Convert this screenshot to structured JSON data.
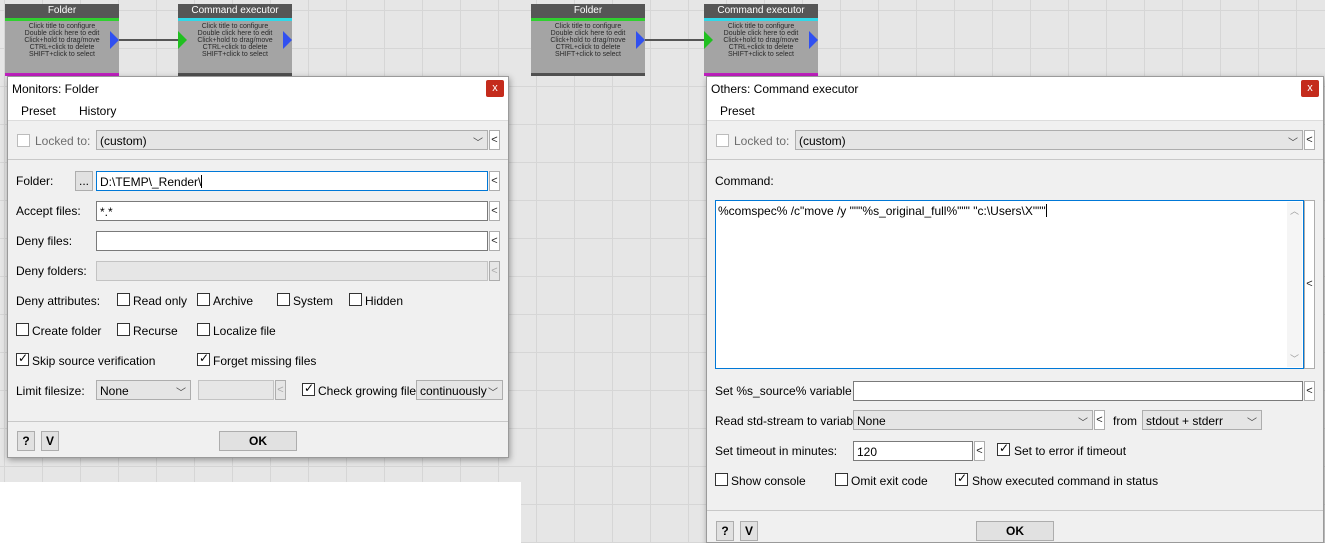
{
  "canvas": {
    "nodes": [
      {
        "title": "Folder",
        "hints": [
          "Click title to configure",
          "Double click here to edit",
          "Click+hold to drag/move",
          "CTRL+click to delete",
          "SHIFT+click to select"
        ]
      },
      {
        "title": "Command executor",
        "hints": [
          "Click title to configure",
          "Double click here to edit",
          "Click+hold to drag/move",
          "CTRL+click to delete",
          "SHIFT+click to select"
        ]
      },
      {
        "title": "Folder",
        "hints": [
          "Click title to configure",
          "Double click here to edit",
          "Click+hold to drag/move",
          "CTRL+click to delete",
          "SHIFT+click to select"
        ]
      },
      {
        "title": "Command executor",
        "hints": [
          "Click title to configure",
          "Double click here to edit",
          "Click+hold to drag/move",
          "CTRL+click to delete",
          "SHIFT+click to select"
        ]
      }
    ],
    "colors": {
      "folder_strip": "#30d030",
      "folder_bottom": "#c020c0",
      "exec_strip": "#30d8e8",
      "exec_bottom_left": "#505050",
      "exec_bottom_right": "#c020c0",
      "input_arrow": "#20c020",
      "output_arrow": "#3050f0"
    }
  },
  "folder_dialog": {
    "title": "Monitors: Folder",
    "close": "x",
    "menu": [
      "Preset",
      "History"
    ],
    "locked_to_label": "Locked to:",
    "locked_to_value": "(custom)",
    "folder_label": "Folder:",
    "browse_label": "...",
    "folder_value": "D:\\TEMP\\_Render\\",
    "accept_label": "Accept files:",
    "accept_value": "*.*",
    "deny_files_label": "Deny files:",
    "deny_files_value": "",
    "deny_folders_label": "Deny folders:",
    "deny_folders_value": "",
    "deny_attributes_label": "Deny attributes:",
    "checkboxes": {
      "read_only": {
        "label": "Read only",
        "checked": false
      },
      "archive": {
        "label": "Archive",
        "checked": false
      },
      "system": {
        "label": "System",
        "checked": false
      },
      "hidden": {
        "label": "Hidden",
        "checked": false
      },
      "create_folder": {
        "label": "Create folder",
        "checked": false
      },
      "recurse": {
        "label": "Recurse",
        "checked": false
      },
      "localize_file": {
        "label": "Localize file",
        "checked": false
      },
      "skip_source": {
        "label": "Skip source verification",
        "checked": true
      },
      "forget_missing": {
        "label": "Forget missing files",
        "checked": true
      },
      "check_growing": {
        "label": "Check growing files",
        "checked": true
      }
    },
    "limit_label": "Limit filesize:",
    "limit_value": "None",
    "growing_mode": "continuously",
    "help_label": "?",
    "v_label": "V",
    "ok_label": "OK"
  },
  "exec_dialog": {
    "title": "Others: Command executor",
    "close": "x",
    "menu": [
      "Preset"
    ],
    "locked_to_label": "Locked to:",
    "locked_to_value": "(custom)",
    "command_label": "Command:",
    "command_value": "%comspec% /c\"move /y  \"\"\"%s_original_full%\"\"\" \"c:\\Users\\X\"\"\"",
    "source_var_label": "Set %s_source% variable to:",
    "source_var_value": "",
    "stream_label": "Read std-stream to variable",
    "stream_value": "None",
    "from_label": "from",
    "from_value": "stdout + stderr",
    "timeout_label": "Set timeout in minutes:",
    "timeout_value": "120",
    "checkboxes": {
      "error_timeout": {
        "label": "Set to error if timeout",
        "checked": true
      },
      "show_console": {
        "label": "Show console",
        "checked": false
      },
      "omit_exit": {
        "label": "Omit exit code",
        "checked": false
      },
      "show_executed": {
        "label": "Show executed command in status",
        "checked": true
      }
    },
    "help_label": "?",
    "v_label": "V",
    "ok_label": "OK"
  }
}
